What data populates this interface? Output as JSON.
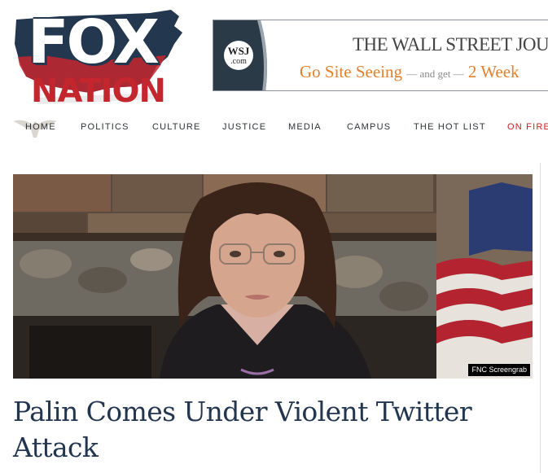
{
  "logo": {
    "top_word": "FOX",
    "bottom_word": "NATION"
  },
  "ad": {
    "badge_top": "WSJ",
    "badge_bottom": ".com",
    "title": "THE WALL STREET JOURNAL.",
    "promo_main": "Go Site Seeing",
    "promo_mid": "— and get —",
    "promo_end": "2 Week"
  },
  "nav": {
    "items": [
      {
        "label": "HOME"
      },
      {
        "label": "POLITICS"
      },
      {
        "label": "CULTURE"
      },
      {
        "label": "JUSTICE"
      },
      {
        "label": "MEDIA"
      },
      {
        "label": "CAMPUS"
      },
      {
        "label": "THE HOT LIST"
      },
      {
        "label": "ON FIRE"
      }
    ]
  },
  "article": {
    "photo_credit": "FNC Screengrab",
    "headline": "Palin Comes Under Violent Twitter Attack"
  },
  "colors": {
    "brand_navy": "#233650",
    "brand_red": "#c4262e",
    "ad_orange": "#e47f2b",
    "nav_fire": "#c9211e"
  }
}
